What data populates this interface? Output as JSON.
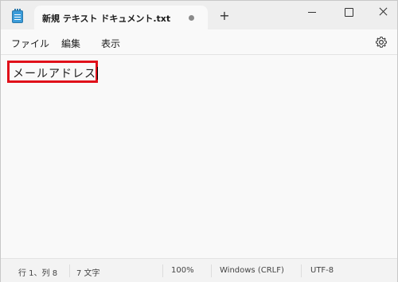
{
  "window": {
    "tab_title": "新規 テキスト ドキュメント.txt",
    "new_tab_label": "+"
  },
  "menu": {
    "items": [
      "ファイル",
      "編集",
      "表示"
    ]
  },
  "editor": {
    "content": "メールアドレス",
    "highlight_color": "#e0101a"
  },
  "status": {
    "position": "行 1、列 8",
    "char_count": "7 文字",
    "zoom": "100%",
    "line_ending": "Windows (CRLF)",
    "encoding": "UTF-8"
  },
  "icons": {
    "app": "notepad-icon",
    "settings": "gear-icon",
    "unsaved": "unsaved-dot-icon"
  }
}
